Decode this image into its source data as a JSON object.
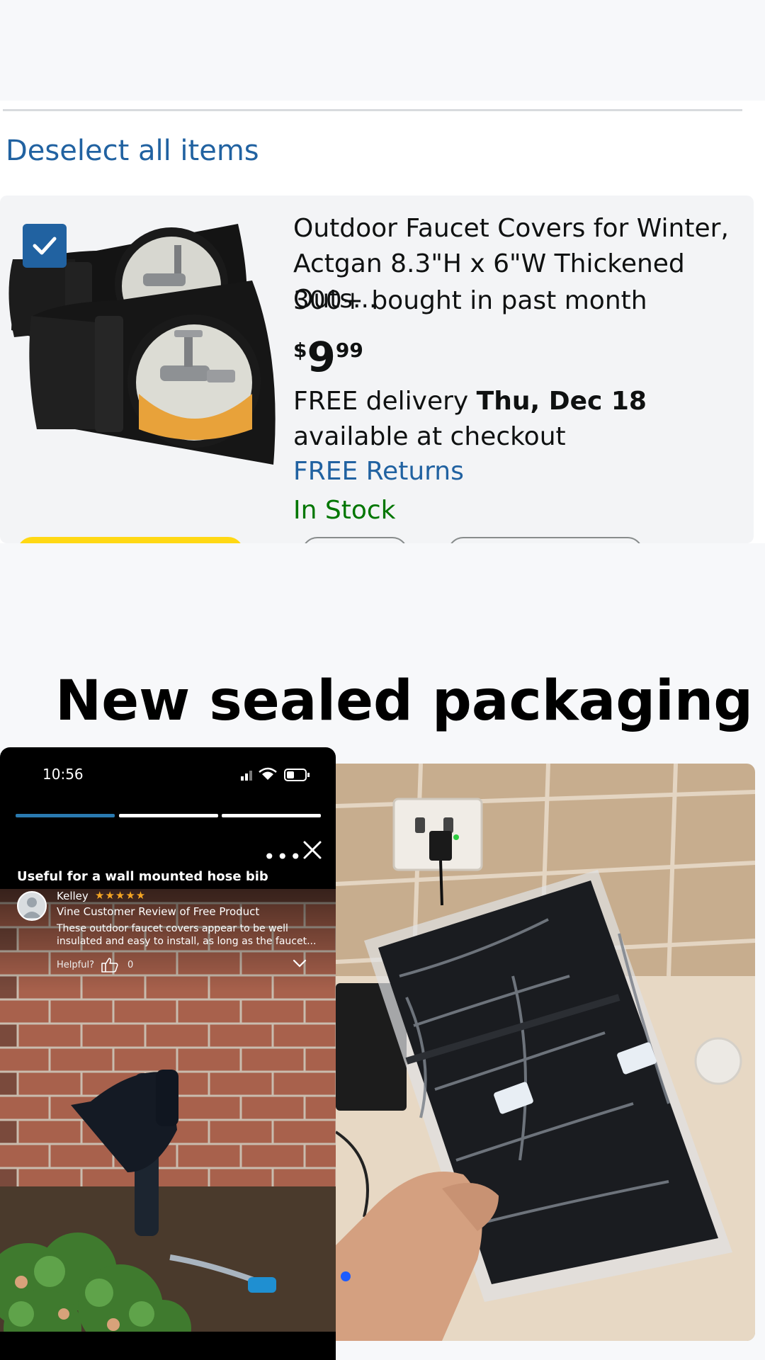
{
  "cart": {
    "deselect_label": "Deselect all items",
    "item": {
      "selected": true,
      "title": "Outdoor Faucet Covers for Winter, Actgan 8.3\"H x 6\"W Thickened Outs...",
      "bought": "300+ bought in past month",
      "price": {
        "currency": "$",
        "whole": "9",
        "fraction": "99"
      },
      "delivery_prefix": "FREE delivery ",
      "delivery_date": "Thu, Dec 18",
      "delivery_suffix": " available at checkout",
      "returns": "FREE Returns",
      "stock": "In Stock"
    }
  },
  "headline": "New sealed packaging",
  "review_screen": {
    "time": "10:56",
    "progress_segments": 3,
    "active_segment": 1,
    "title": "Useful for a wall mounted hose bib",
    "reviewer": "Kelley",
    "stars": "★★★★★",
    "rating": 5,
    "badge": "Vine Customer Review of Free Product",
    "text": "These outdoor faucet covers appear to be well insulated and easy to install, as long as the faucet...",
    "helpful_label": "Helpful?",
    "helpful_count": "0",
    "more_icon": "more-icon",
    "close_icon": "close-icon"
  },
  "colors": {
    "link": "#2162a1",
    "stock": "#007600",
    "checkbox": "#2162a1",
    "primary_button": "#ffd814",
    "star": "#f5a623"
  }
}
